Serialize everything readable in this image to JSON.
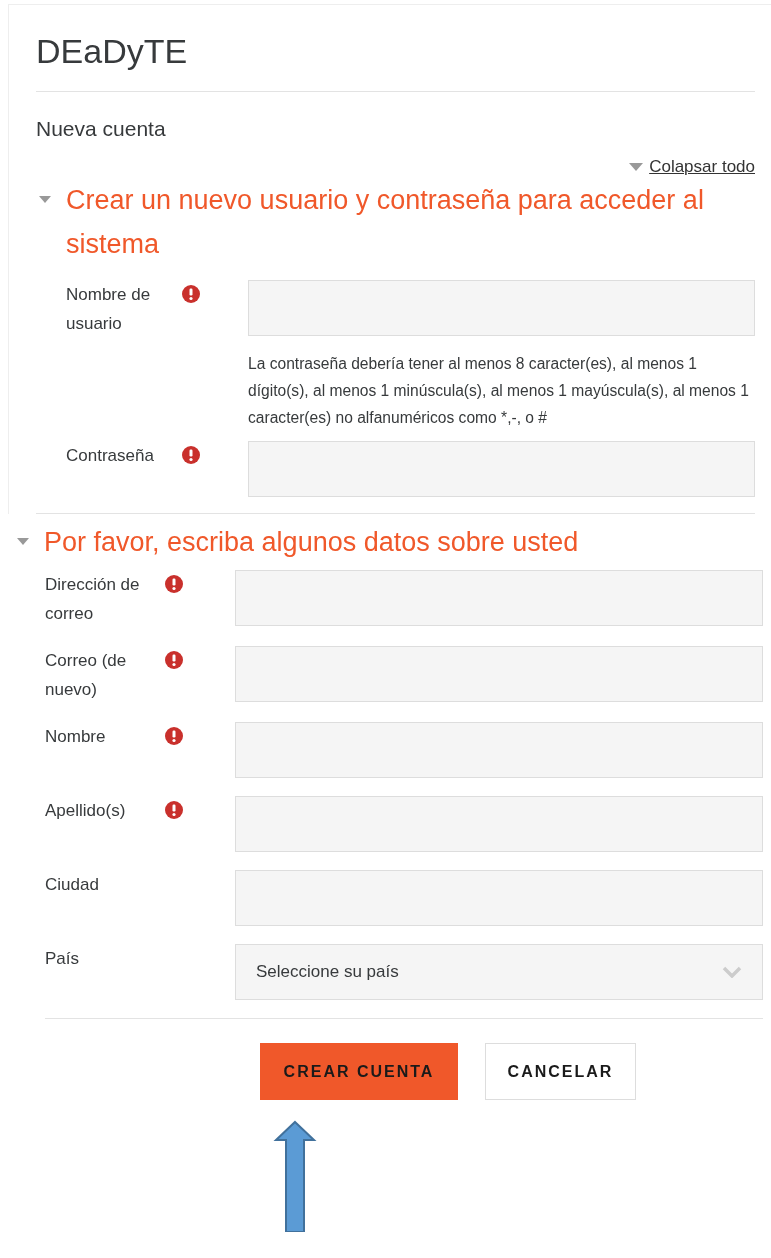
{
  "site_title": "DEaDyTE",
  "page_heading": "Nueva cuenta",
  "collapse_all": "Colapsar todo",
  "sections": [
    {
      "title": "Crear un nuevo usuario y contraseña para acceder al sistema",
      "expanded": true,
      "fields": [
        {
          "kind": "text",
          "label": "Nombre de usuario",
          "required": true
        },
        {
          "kind": "note",
          "text": "La contraseña debería tener al menos 8 caracter(es), al menos 1 dígito(s), al menos 1 minúscula(s), al menos 1 mayúscula(s), al menos 1 caracter(es) no alfanuméricos como *,-, o #"
        },
        {
          "kind": "text",
          "label": "Contraseña",
          "required": true
        }
      ]
    },
    {
      "title": "Por favor, escriba algunos datos sobre usted",
      "expanded": true,
      "fields": [
        {
          "kind": "text",
          "label": "Dirección de correo",
          "required": true
        },
        {
          "kind": "text",
          "label": "Correo (de nuevo)",
          "required": true
        },
        {
          "kind": "text",
          "label": "Nombre",
          "required": true
        },
        {
          "kind": "text",
          "label": "Apellido(s)",
          "required": true
        },
        {
          "kind": "text",
          "label": "Ciudad",
          "required": false
        },
        {
          "kind": "select",
          "label": "País",
          "required": false,
          "value": "Seleccione su país"
        }
      ]
    }
  ],
  "buttons": [
    {
      "label": "CREAR CUENTA",
      "kind": "primary"
    },
    {
      "label": "CANCELAR",
      "kind": "secondary"
    }
  ]
}
